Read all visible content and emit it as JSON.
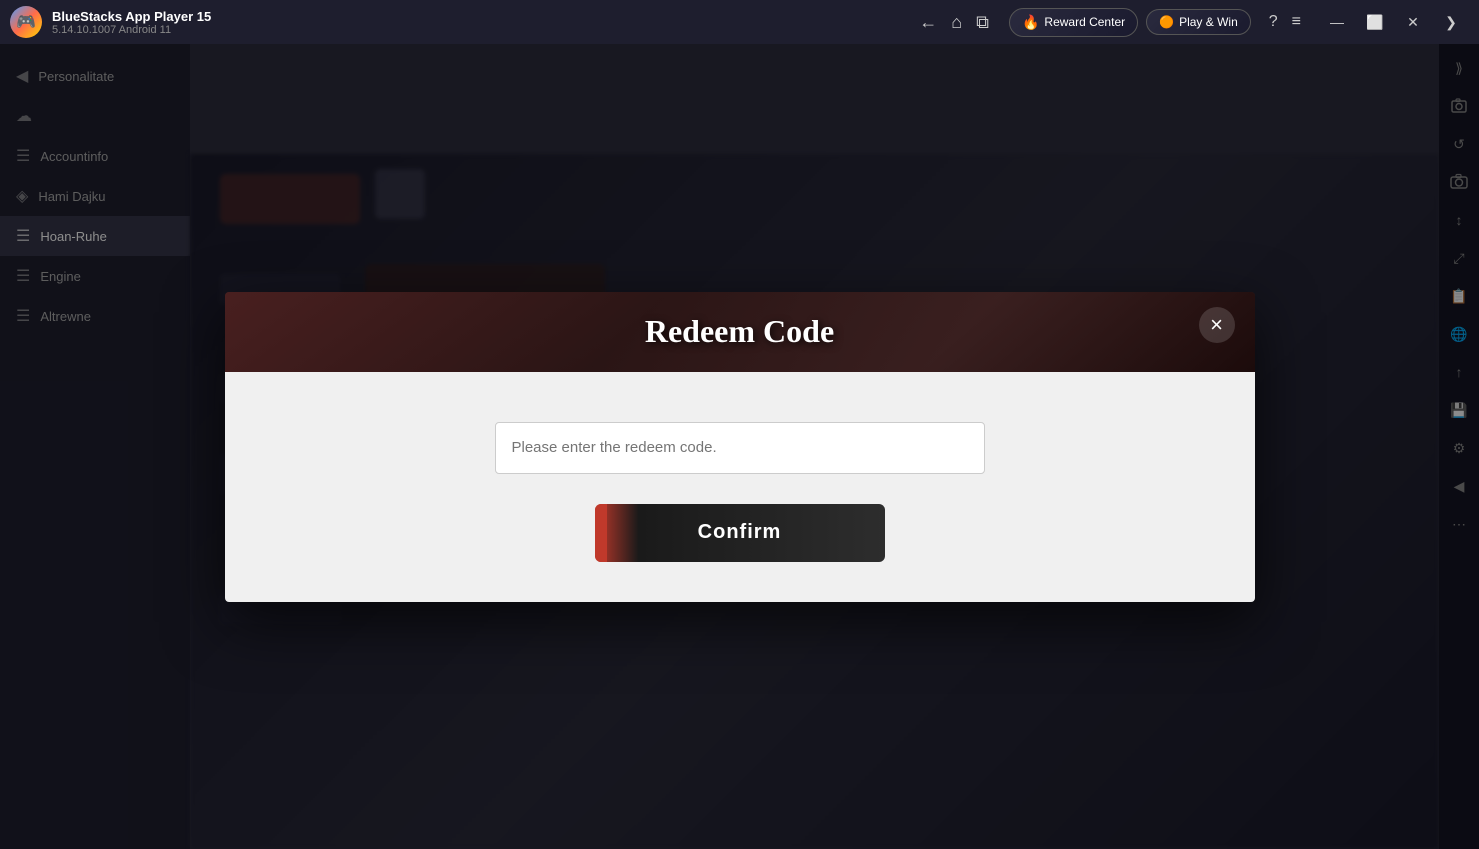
{
  "titlebar": {
    "app_name": "BlueStacks App Player 15",
    "app_version": "5.14.10.1007  Android 11",
    "logo_emoji": "🎮",
    "nav": {
      "back_label": "←",
      "home_label": "⌂",
      "tabs_label": "⧉"
    },
    "reward_center": "Reward Center",
    "play_win": "Play & Win",
    "icons": [
      "?",
      "≡",
      "—",
      "⬜",
      "✕",
      "❯"
    ]
  },
  "sidebar": {
    "items": [
      {
        "label": "Personalitate",
        "icon": "◀",
        "active": false
      },
      {
        "label": "",
        "icon": "☁",
        "active": false
      },
      {
        "label": "Accountinfo",
        "icon": "☰",
        "active": false
      },
      {
        "label": "Hami Dajku",
        "icon": "◈",
        "active": false
      },
      {
        "label": "Hoan-Ruhe",
        "icon": "☰",
        "active": true
      },
      {
        "label": "Engine",
        "icon": "☰",
        "active": false
      },
      {
        "label": "Altrewne",
        "icon": "☰",
        "active": false
      }
    ]
  },
  "right_sidebar": {
    "icons": [
      "❯❯",
      "📷",
      "🔄",
      "📸",
      "⬆⬇",
      "📐",
      "📋",
      "🌐",
      "📤",
      "💾",
      "⚙",
      "◀",
      "⋯"
    ]
  },
  "modal": {
    "title": "Redeem Code",
    "close_label": "×",
    "input_placeholder": "Please enter the redeem code.",
    "confirm_label": "Confirm"
  }
}
